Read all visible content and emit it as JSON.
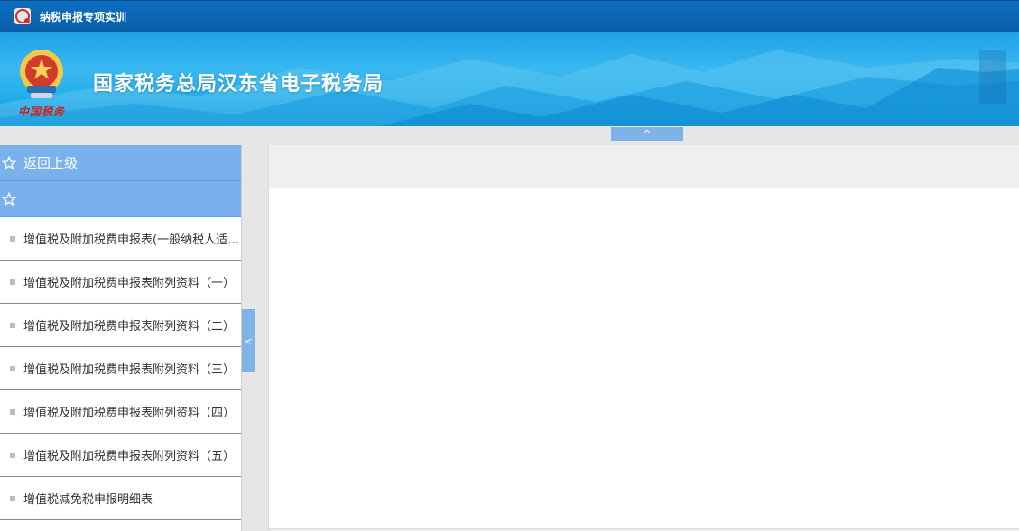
{
  "app": {
    "title": "纳税申报专项实训"
  },
  "banner": {
    "title": "国家税务总局汉东省电子税务局",
    "emblem_caption": "中国税务"
  },
  "collapse_top": {
    "label": "^"
  },
  "sidebar": {
    "back_label": "返回上级",
    "section_label": "",
    "items": [
      {
        "label": "增值税及附加税费申报表(一般纳税人适用)"
      },
      {
        "label": "增值税及附加税费申报表附列资料（一）"
      },
      {
        "label": "增值税及附加税费申报表附列资料（二）"
      },
      {
        "label": "增值税及附加税费申报表附列资料（三）"
      },
      {
        "label": "增值税及附加税费申报表附列资料（四）"
      },
      {
        "label": "增值税及附加税费申报表附列资料（五）"
      },
      {
        "label": "增值税减免税申报明细表"
      }
    ],
    "toggle_label": "<"
  }
}
